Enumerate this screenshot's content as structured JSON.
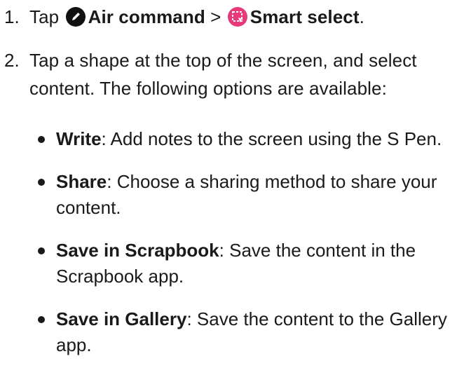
{
  "steps": [
    {
      "number": "1.",
      "prefix": "Tap",
      "item1_icon": "pen-circle-icon",
      "item1_label": "Air command",
      "separator": ">",
      "item2_icon": "smart-select-icon",
      "item2_label": "Smart select",
      "suffix": "."
    },
    {
      "number": "2.",
      "text": "Tap a shape at the top of the screen, and select content. The following options are available:"
    }
  ],
  "options": [
    {
      "term": "Write",
      "description": ": Add notes to the screen using the S Pen."
    },
    {
      "term": "Share",
      "description": ": Choose a sharing method to share your content."
    },
    {
      "term": "Save in Scrapbook",
      "description": ": Save the content in the Scrapbook app."
    },
    {
      "term": "Save in Gallery",
      "description": ": Save the content to the Gallery app."
    }
  ],
  "colors": {
    "text": "#1a1a1a",
    "pen_icon_bg": "#111111",
    "smart_select_icon_bg": "#e8397a"
  }
}
